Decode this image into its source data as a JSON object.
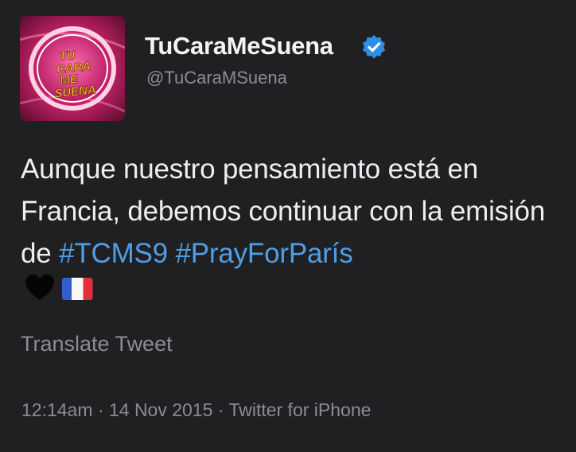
{
  "user": {
    "display_name": "TuCaraMeSuena",
    "handle": "@TuCaraMSuena",
    "verified": true,
    "avatar_logo_text": "TU CARA ME SUENA"
  },
  "tweet": {
    "text_part1": "Aunque nuestro pensamiento está en Francia, debemos continuar con la emisión de ",
    "hashtag1": "#TCMS9",
    "space": " ",
    "hashtag2": "#PrayForParís",
    "emojis": [
      "black-heart",
      "flag-france"
    ]
  },
  "actions": {
    "translate_label": "Translate Tweet"
  },
  "meta": {
    "time": "12:14am",
    "separator": " · ",
    "date": "14 Nov 2015",
    "source": "Twitter for iPhone"
  },
  "colors": {
    "background": "#202023",
    "hashtag": "#4f9ee6",
    "verified_badge": "#2f8fe6",
    "muted_text": "#8a8d93"
  }
}
